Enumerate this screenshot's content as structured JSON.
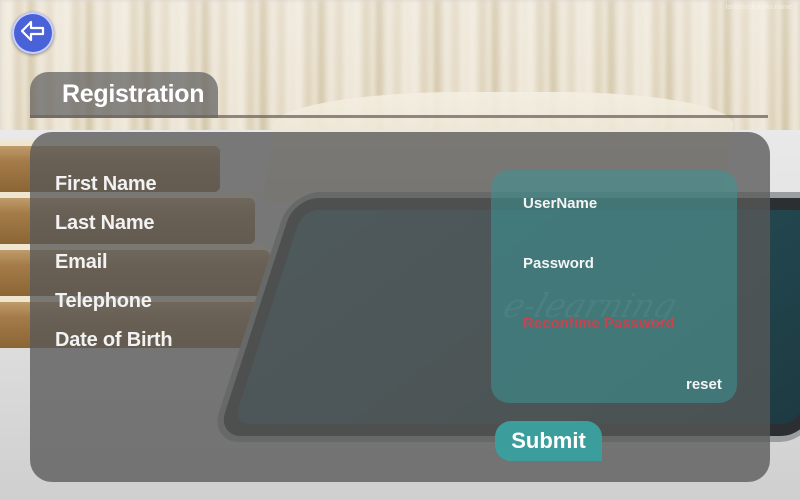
{
  "header": {
    "back_icon": "arrow-left-icon",
    "title": "Registration",
    "watermark": "lovestockphoto.name"
  },
  "form": {
    "fields": [
      {
        "label": "First Name"
      },
      {
        "label": "Last Name"
      },
      {
        "label": "Email"
      },
      {
        "label": "Telephone"
      },
      {
        "label": "Date of Birth"
      }
    ]
  },
  "account": {
    "username_label": "UserName",
    "password_label": "Password",
    "reconfirm_label": "Reconfime Password",
    "reset_label": "reset"
  },
  "actions": {
    "submit_label": "Submit"
  },
  "background": {
    "screen_text": "e-learning"
  },
  "colors": {
    "accent": "#3c9e9c",
    "back_button": "#4a62d8",
    "warning_text": "#c9424e"
  }
}
